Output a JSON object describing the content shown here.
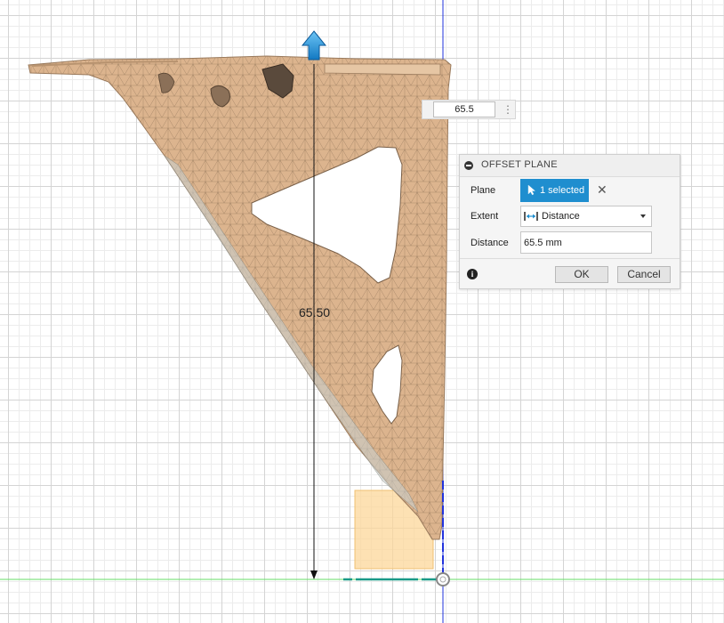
{
  "viewport": {
    "dimension_label": "65.50",
    "value_box": {
      "value": "65.5"
    }
  },
  "dialog": {
    "title": "OFFSET PLANE",
    "plane_label": "Plane",
    "plane_selection": "1 selected",
    "extent_label": "Extent",
    "extent_value": "Distance",
    "distance_label": "Distance",
    "distance_value": "65.5 mm",
    "ok_label": "OK",
    "cancel_label": "Cancel"
  },
  "colors": {
    "part_fill": "#dcb48e",
    "mesh_line": "#8a6f55",
    "accent_blue": "#1f8ecf",
    "plane_fill": "#fcd79a",
    "axis_green": "#66dd66",
    "axis_blue": "#2233dd"
  }
}
